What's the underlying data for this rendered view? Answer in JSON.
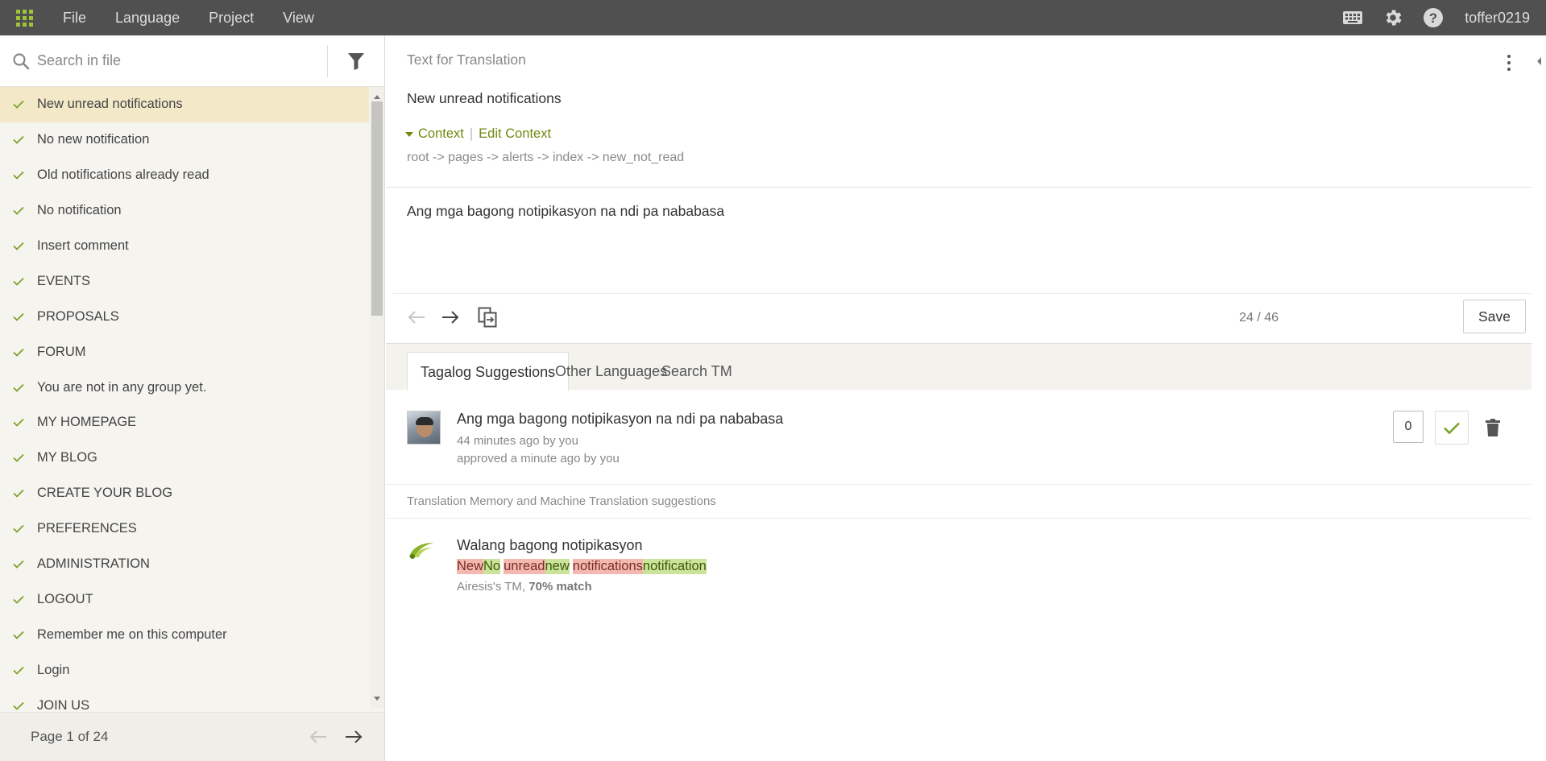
{
  "menu": {
    "file": "File",
    "language": "Language",
    "project": "Project",
    "view": "View",
    "username": "toffer0219"
  },
  "icons": {
    "apps": "apps-grid-icon",
    "keyboard": "keyboard-icon",
    "settings": "gear-icon",
    "help": "help-icon",
    "search": "search-icon",
    "filter": "filter-icon",
    "check": "check-icon",
    "copy": "copy-source-icon",
    "trash": "trash-icon"
  },
  "colors": {
    "topbar": "#505050",
    "accent": "#6d8a10",
    "active_row": "#f3e9c8",
    "removed": "#f3b9b0",
    "added": "#cbe39a"
  },
  "sidebar": {
    "search_placeholder": "Search in file",
    "items": [
      {
        "label": "New unread notifications",
        "active": true
      },
      {
        "label": "No new notification"
      },
      {
        "label": "Old notifications already read"
      },
      {
        "label": "No notification"
      },
      {
        "label": "Insert comment"
      },
      {
        "label": "EVENTS"
      },
      {
        "label": "PROPOSALS"
      },
      {
        "label": "FORUM"
      },
      {
        "label": "You are not in any group yet."
      },
      {
        "label": "MY HOMEPAGE"
      },
      {
        "label": "MY BLOG"
      },
      {
        "label": "CREATE YOUR BLOG"
      },
      {
        "label": "PREFERENCES"
      },
      {
        "label": "ADMINISTRATION"
      },
      {
        "label": "LOGOUT"
      },
      {
        "label": "Remember me on this computer"
      },
      {
        "label": "Login"
      },
      {
        "label": "JOIN US"
      }
    ],
    "pager": "Page 1 of 24"
  },
  "editor": {
    "source_header": "Text for Translation",
    "source_text": "New unread notifications",
    "context_label": "Context",
    "context_separator": "|",
    "edit_context_label": "Edit Context",
    "context_path": "root -> pages -> alerts -> index -> new_not_read",
    "translation": "Ang mga bagong notipikasyon na ndi pa nababasa",
    "counter": "24 / 46",
    "save_label": "Save"
  },
  "tabs": [
    {
      "label": "Tagalog Suggestions",
      "active": true
    },
    {
      "label": "Other Languages"
    },
    {
      "label": "Search TM"
    }
  ],
  "suggestion": {
    "text": "Ang mga bagong notipikasyon na ndi pa nababasa",
    "meta_time": "44 minutes ago by you",
    "meta_approved": "approved a minute ago by you",
    "votes": "0"
  },
  "tm": {
    "header": "Translation Memory and Machine Translation suggestions",
    "text": "Walang bagong notipikasyon",
    "diff": [
      {
        "text": "New",
        "type": "del"
      },
      {
        "text": "No",
        "type": "ins"
      },
      {
        "text": "unread",
        "type": "del"
      },
      {
        "text": "new",
        "type": "ins"
      },
      {
        "text": "notifications",
        "type": "del"
      },
      {
        "text": "notification",
        "type": "ins"
      }
    ],
    "source_name": "Airesis's TM, ",
    "match": "70% match"
  }
}
